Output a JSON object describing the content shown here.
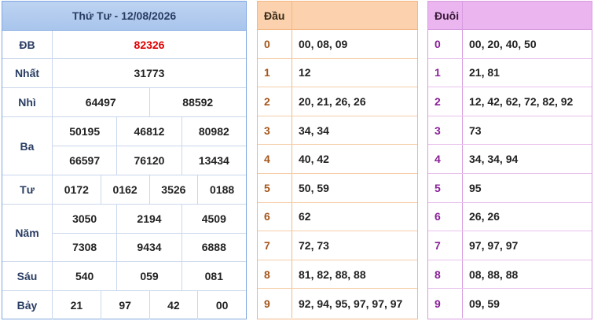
{
  "results": {
    "title": "Thứ Tư - 12/08/2026",
    "prizes": [
      {
        "label": "ĐB",
        "rows": [
          [
            "82326"
          ]
        ],
        "highlight": true
      },
      {
        "label": "Nhất",
        "rows": [
          [
            "31773"
          ]
        ]
      },
      {
        "label": "Nhì",
        "rows": [
          [
            "64497",
            "88592"
          ]
        ]
      },
      {
        "label": "Ba",
        "rows": [
          [
            "50195",
            "46812",
            "80982"
          ],
          [
            "66597",
            "76120",
            "13434"
          ]
        ]
      },
      {
        "label": "Tư",
        "rows": [
          [
            "0172",
            "0162",
            "3526",
            "0188"
          ]
        ]
      },
      {
        "label": "Năm",
        "rows": [
          [
            "3050",
            "2194",
            "4509"
          ],
          [
            "7308",
            "9434",
            "6888"
          ]
        ]
      },
      {
        "label": "Sáu",
        "rows": [
          [
            "540",
            "059",
            "081"
          ]
        ]
      },
      {
        "label": "Bảy",
        "rows": [
          [
            "21",
            "97",
            "42",
            "00"
          ]
        ]
      }
    ],
    "colors": {
      "special": "#e00000",
      "header_bg": "#bdd3f1",
      "border": "#7fa8e0"
    }
  },
  "head_table": {
    "title": "Đầu",
    "rows": [
      {
        "k": "0",
        "v": "00, 08, 09"
      },
      {
        "k": "1",
        "v": "12"
      },
      {
        "k": "2",
        "v": "20, 21, 26, 26"
      },
      {
        "k": "3",
        "v": "34, 34"
      },
      {
        "k": "4",
        "v": "40, 42"
      },
      {
        "k": "5",
        "v": "50, 59"
      },
      {
        "k": "6",
        "v": "62"
      },
      {
        "k": "7",
        "v": "72, 73"
      },
      {
        "k": "8",
        "v": "81, 82, 88, 88"
      },
      {
        "k": "9",
        "v": "92, 94, 95, 97, 97, 97"
      }
    ],
    "colors": {
      "header_bg": "#fbd2ad",
      "key": "#a4561b"
    }
  },
  "tail_table": {
    "title": "Đuôi",
    "rows": [
      {
        "k": "0",
        "v": "00, 20, 40, 50"
      },
      {
        "k": "1",
        "v": "21, 81"
      },
      {
        "k": "2",
        "v": "12, 42, 62, 72, 82, 92"
      },
      {
        "k": "3",
        "v": "73"
      },
      {
        "k": "4",
        "v": "34, 34, 94"
      },
      {
        "k": "5",
        "v": "95"
      },
      {
        "k": "6",
        "v": "26, 26"
      },
      {
        "k": "7",
        "v": "97, 97, 97"
      },
      {
        "k": "8",
        "v": "08, 88, 88"
      },
      {
        "k": "9",
        "v": "09, 59"
      }
    ],
    "colors": {
      "header_bg": "#ebb6ef",
      "key": "#8a1f98"
    }
  }
}
